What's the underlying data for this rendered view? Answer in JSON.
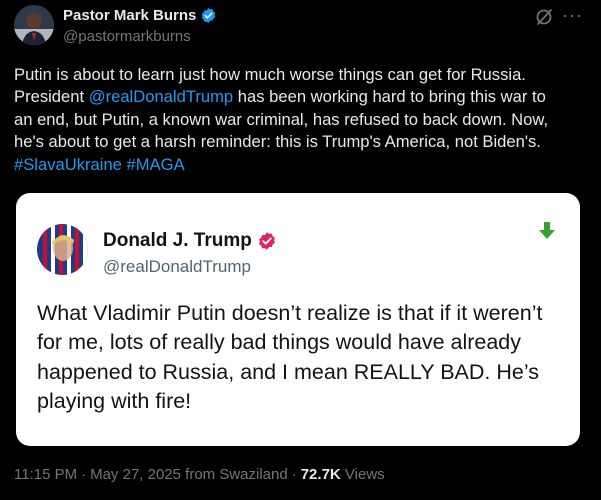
{
  "post": {
    "author": {
      "display_name": "Pastor Mark Burns",
      "handle": "@pastormarkburns",
      "verified": true
    },
    "text": {
      "line_1": "Putin is about to learn just how much worse things can get for Russia.",
      "line_2_pre": "President ",
      "mention": "@realDonaldTrump",
      "line_2_post": " has been working hard to bring this war to",
      "line_3": "an end, but Putin, a known war criminal, has refused to back down. Now,",
      "line_4": "he's about to get a harsh reminder: this is Trump's America, not Biden's.",
      "hashtag_1": "#SlavaUkraine",
      "hashtag_2": "#MAGA"
    },
    "icons": {
      "grok": "grok-icon",
      "more": "more-icon"
    },
    "more_glyph": "···"
  },
  "quote": {
    "author": {
      "display_name": "Donald J. Trump",
      "handle": "@realDonaldTrump",
      "verified": true
    },
    "text": "What Vladimir Putin doesn’t realize is that if it weren’t for me, lots of really bad things would have already happened to Russia, and I mean REALLY BAD. He’s playing with fire!",
    "icons": {
      "arrow": "green-down-arrow-icon"
    }
  },
  "meta": {
    "time": "11:15 PM",
    "date": "May 27, 2025",
    "source": "from Swaziland",
    "separator": "·",
    "views_count": "72.7K",
    "views_label": "Views"
  },
  "colors": {
    "background": "#000000",
    "text": "#e7e9ea",
    "secondary": "#71767b",
    "link": "#1d9bf0",
    "verified": "#1d9bf0",
    "quote_verified": "#e0245e",
    "arrow_green": "#3ba12d"
  }
}
